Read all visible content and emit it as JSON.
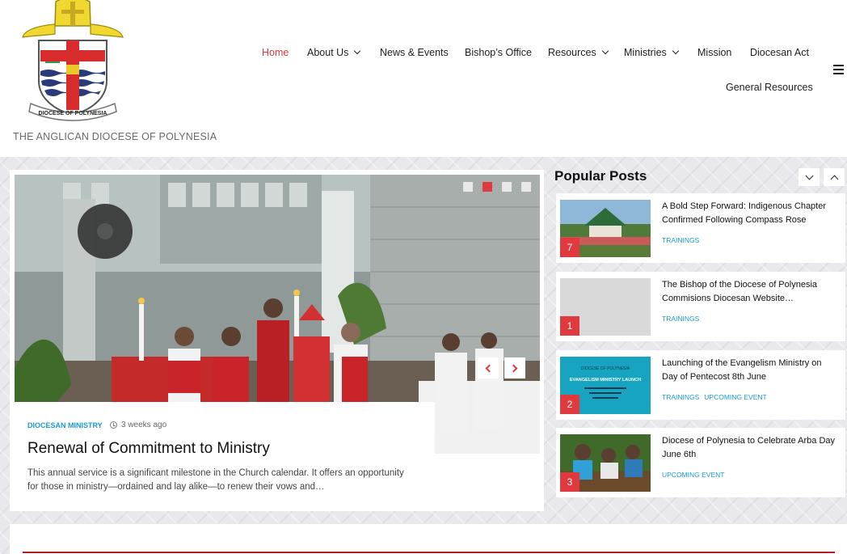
{
  "site": {
    "tagline": "THE ANGLICAN DIOCESE OF POLYNESIA",
    "logo_text": "DIOCESE OF POLYNESIA"
  },
  "nav": {
    "items": [
      {
        "label": "Home",
        "active": true,
        "has_dropdown": false
      },
      {
        "label": "About Us",
        "active": false,
        "has_dropdown": true
      },
      {
        "label": "News & Events",
        "active": false,
        "has_dropdown": false
      },
      {
        "label": "Bishop’s Office",
        "active": false,
        "has_dropdown": false
      },
      {
        "label": "Resources",
        "active": false,
        "has_dropdown": true
      },
      {
        "label": "Ministries",
        "active": false,
        "has_dropdown": true
      },
      {
        "label": "Mission",
        "active": false,
        "has_dropdown": false
      },
      {
        "label": "Diocesan Act",
        "active": false,
        "has_dropdown": false
      },
      {
        "label": "General Resources",
        "active": false,
        "has_dropdown": false
      }
    ]
  },
  "slider": {
    "total_slides": 4,
    "active_slide": 2,
    "category": "DIOCESAN MINISTRY",
    "time": "3 weeks ago",
    "title": "Renewal of Commitment to Ministry",
    "excerpt": "This annual service is a significant milestone in the Church calendar. It offers an opportunity for those in ministry—ordained and lay alike—to renew their vows and…"
  },
  "popular": {
    "heading": "Popular Posts",
    "posts": [
      {
        "rank": "7",
        "title": "A Bold Step Forward: Indigenous Chapter Confirmed Following Compass Rose Socie…",
        "tags": [
          "TRAININGS"
        ]
      },
      {
        "rank": "1",
        "title": "The Bishop of the Diocese of Polynesia Commisions Diocesan Website…",
        "tags": [
          "TRAININGS"
        ]
      },
      {
        "rank": "2",
        "title": "Launching of the Evangelism Ministry on Day of Pentecost 8th June",
        "tags": [
          "TRAININGS",
          "UPCOMING EVENT"
        ]
      },
      {
        "rank": "3",
        "title": "Diocese of Polynesia to Celebrate Arba Day June 6th",
        "tags": [
          "UPCOMING EVENT"
        ]
      }
    ],
    "thumb_texts": {
      "line1": "DIOCESE OF POLYNESIA",
      "line2": "EVANGELISM MINISTRY LAUNCH"
    }
  },
  "colors": {
    "accent": "#e0393e",
    "link": "#1b9ad6",
    "band": "#e9e9ed"
  }
}
